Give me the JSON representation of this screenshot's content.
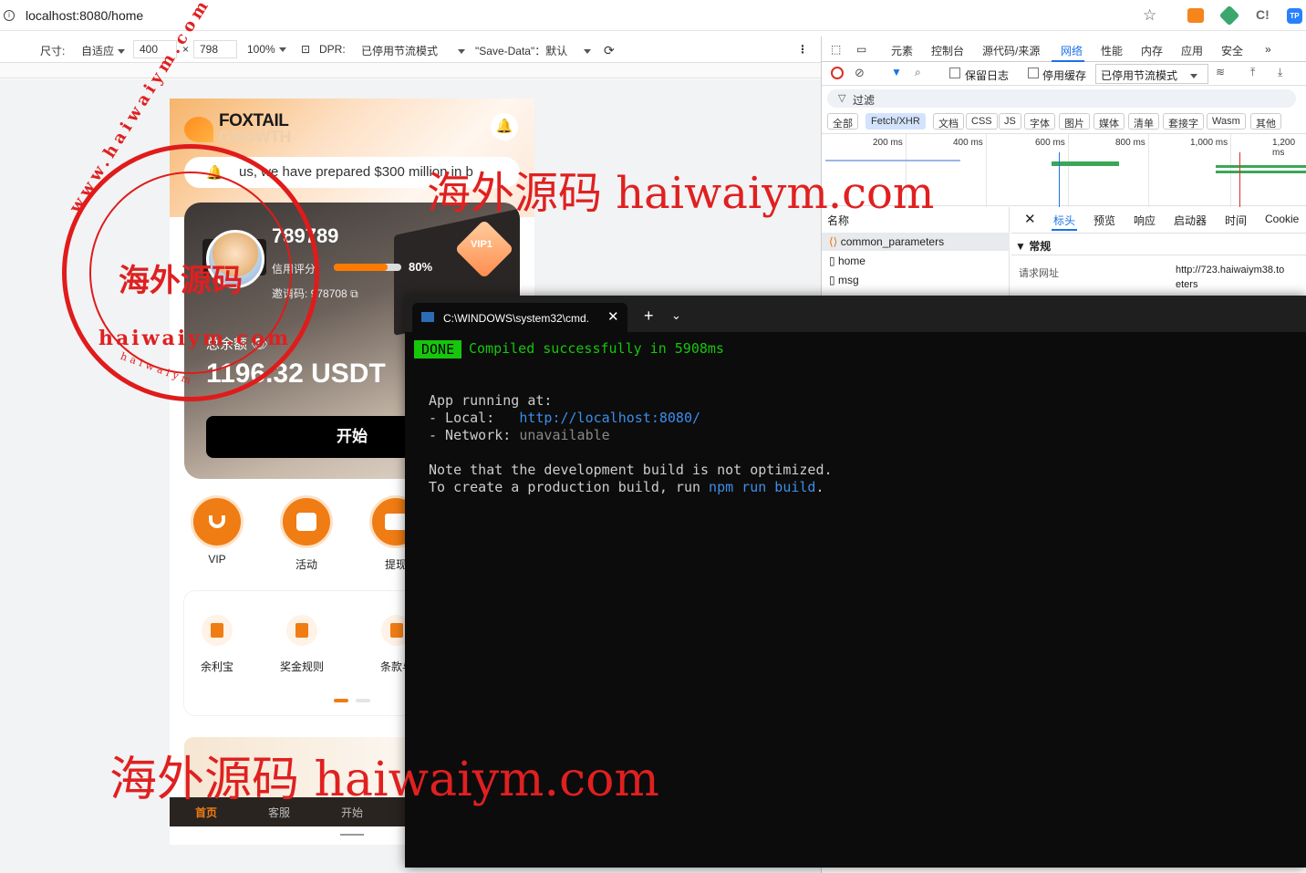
{
  "browser": {
    "url": "localhost:8080/home"
  },
  "device_toolbar": {
    "size_label": "尺寸:",
    "preset": "自适应",
    "width": "400",
    "times": "×",
    "height": "798",
    "zoom": "100%",
    "dpr_label": "DPR:",
    "throttle": "已停用节流模式",
    "save_data": "\"Save-Data\"：默认"
  },
  "app": {
    "logo_main": "FOXTAIL",
    "logo_sub": "GROWTH",
    "marquee": "us, we have prepared $300 million in b",
    "username": "789789",
    "credit_label": "信用评分:",
    "credit_value": "80%",
    "credit_fraction": 0.8,
    "invite": "邀请码: 978708",
    "vip": "VIP1",
    "balance_label": "总余额",
    "balance": "1196.32 USDT",
    "start_button": "开始",
    "quick": [
      {
        "label": "VIP",
        "icon": "diamond-icon"
      },
      {
        "label": "活动",
        "icon": "document-icon"
      },
      {
        "label": "提现",
        "icon": "wallet-icon"
      }
    ],
    "services": [
      {
        "label": "余利宝",
        "icon": "ledger-icon"
      },
      {
        "label": "奖金规则",
        "icon": "rules-icon"
      },
      {
        "label": "条款与",
        "icon": "terms-icon"
      }
    ],
    "tabs": {
      "home": "首页",
      "service": "客服",
      "start": "开始"
    }
  },
  "devtools": {
    "tabs": [
      "元素",
      "控制台",
      "源代码/来源",
      "网络",
      "性能",
      "内存",
      "应用",
      "安全"
    ],
    "preserve_log": "保留日志",
    "disable_cache": "停用缓存",
    "throttle": "已停用节流模式",
    "filter": "过滤",
    "types": [
      "全部",
      "Fetch/XHR",
      "文档",
      "CSS",
      "JS",
      "字体",
      "图片",
      "媒体",
      "清单",
      "套接字",
      "Wasm",
      "其他"
    ],
    "timeline": [
      "200 ms",
      "400 ms",
      "600 ms",
      "800 ms",
      "1,000 ms",
      "1,200 ms"
    ],
    "name_header": "名称",
    "requests": [
      "common_parameters",
      "home",
      "msg"
    ],
    "detail_tabs": [
      "标头",
      "预览",
      "响应",
      "启动器",
      "时间",
      "Cookie"
    ],
    "general": "▼ 常规",
    "request_url_label": "请求网址",
    "request_url": "http://723.haiwaiym38.to",
    "request_url_2": "eters"
  },
  "terminal": {
    "title": "C:\\WINDOWS\\system32\\cmd.",
    "done": "DONE",
    "compiled": "Compiled successfully in 5908ms",
    "line1": "App running at:",
    "line2a": "- Local:   ",
    "line2b": "http://localhost:8080/",
    "line3a": "- Network: ",
    "line3b": "unavailable",
    "line4": "Note that the development build is not optimized.",
    "line5a": "To create a production build, run ",
    "line5b": "npm run build",
    "line5c": "."
  },
  "watermark": {
    "text1": "海外源码 haiwaiym.com",
    "text2": "海外源码 haiwaiym.com",
    "seal_center": "海外源码",
    "seal_url": "haiwaiym.com",
    "seal_arc": "www.haiwaiym.com",
    "seal_small": "haiwaiym"
  },
  "colors": {
    "accent": "#f07c14",
    "terminal_green": "#16c60c",
    "link_blue": "#3b8eea",
    "watermark_red": "#e02020"
  }
}
